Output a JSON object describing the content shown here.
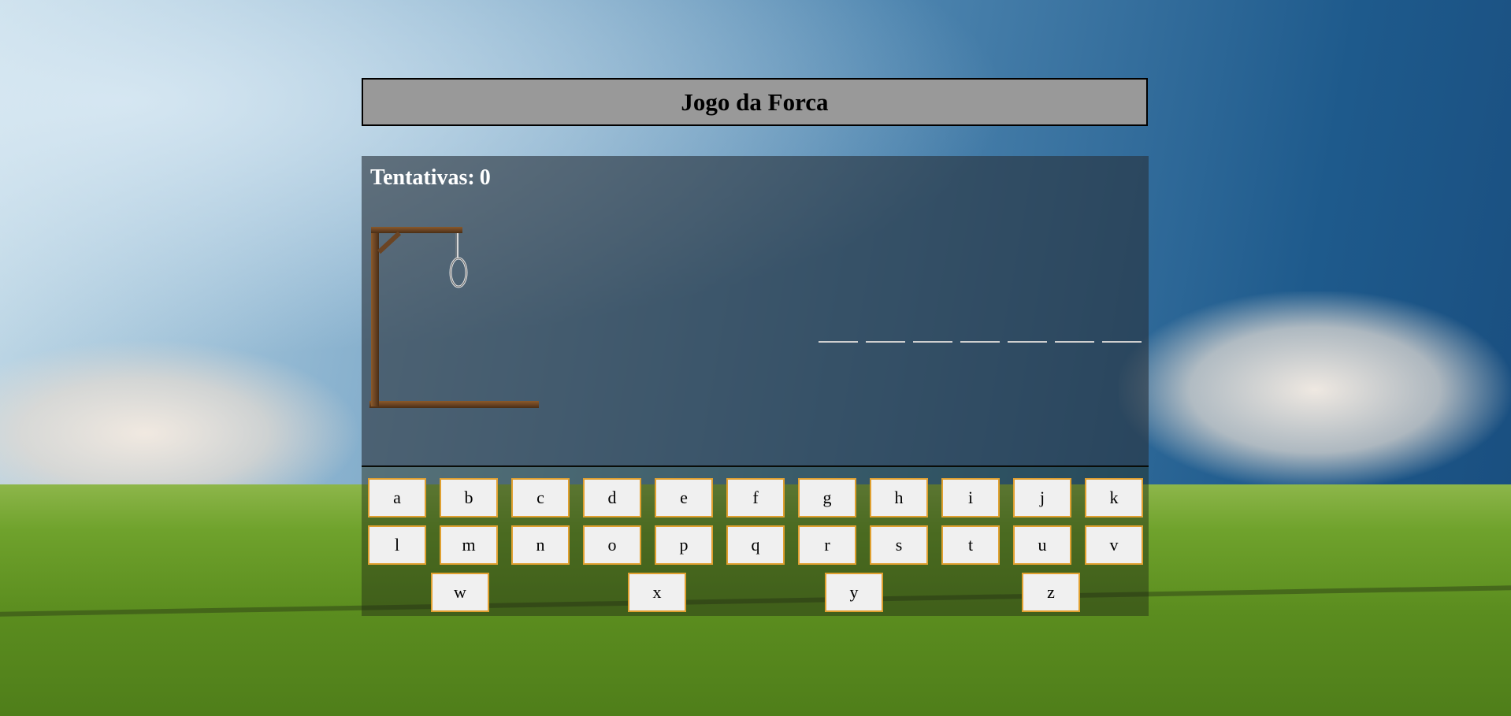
{
  "title": "Jogo da Forca",
  "attempts": {
    "label": "Tentativas:",
    "value": "0"
  },
  "word": {
    "letter_count": 7
  },
  "keyboard": {
    "rows": [
      [
        "a",
        "b",
        "c",
        "d",
        "e",
        "f",
        "g",
        "h",
        "i",
        "j",
        "k"
      ],
      [
        "l",
        "m",
        "n",
        "o",
        "p",
        "q",
        "r",
        "s",
        "t",
        "u",
        "v"
      ],
      [
        "w",
        "x",
        "y",
        "z"
      ]
    ]
  },
  "colors": {
    "header_bg": "#999999",
    "key_border": "#e0a030",
    "key_bg": "#f0f0f0",
    "gallows_wood": "#6b4423"
  }
}
